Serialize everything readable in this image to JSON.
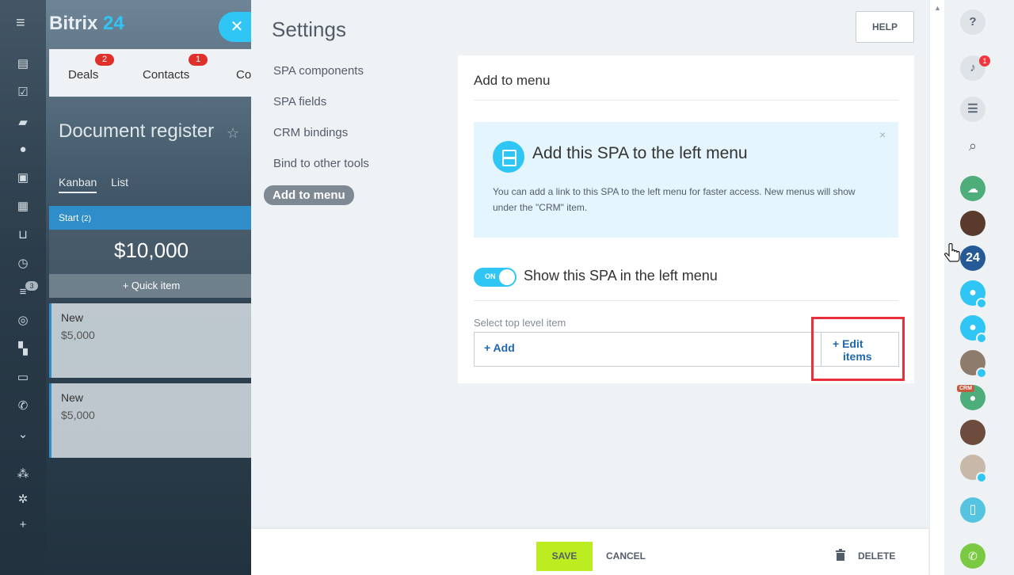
{
  "background_app": {
    "logo_main": "Bitrix",
    "logo_accent": "24",
    "tabs": [
      {
        "label": "Deals",
        "badge": "2"
      },
      {
        "label": "Contacts",
        "badge": "1"
      },
      {
        "label": "Co"
      }
    ],
    "page_title": "Document register",
    "view_tabs": [
      "Kanban",
      "List"
    ],
    "stage": {
      "name": "Start",
      "count": "(2)",
      "sum": "$10,000"
    },
    "quick_item": "+ Quick item",
    "cards": [
      {
        "title": "New",
        "value": "$5,000"
      },
      {
        "title": "New",
        "value": "$5,000"
      }
    ],
    "sidebar_badge": "3"
  },
  "settings": {
    "title": "Settings",
    "help_label": "HELP",
    "nav": [
      {
        "label": "SPA components"
      },
      {
        "label": "SPA fields"
      },
      {
        "label": "CRM bindings"
      },
      {
        "label": "Bind to other tools"
      },
      {
        "label": "Add to menu",
        "active": true
      }
    ],
    "panel": {
      "title": "Add to menu",
      "info_title": "Add this SPA to the left menu",
      "info_text": "You can add a link to this SPA to the left menu for faster access. New menus will show under the \"CRM\" item.",
      "info_close": "×",
      "toggle_label": "ON",
      "toggle_on": true,
      "toggle_text": "Show this SPA in the left menu",
      "select_label": "Select top level item",
      "add_label": "+ Add",
      "edit_label_line1": "+ Edit",
      "edit_label_line2": "items"
    },
    "footer": {
      "save": "SAVE",
      "cancel": "CANCEL",
      "delete": "DELETE"
    }
  },
  "right_panel": {
    "notification_count": "1",
    "crm_tag": "CRM",
    "b24_label": "24"
  },
  "colors": {
    "accent": "#2fc6f6",
    "save": "#bbed21",
    "highlight": "#e8303a",
    "link": "#1f67b0"
  }
}
